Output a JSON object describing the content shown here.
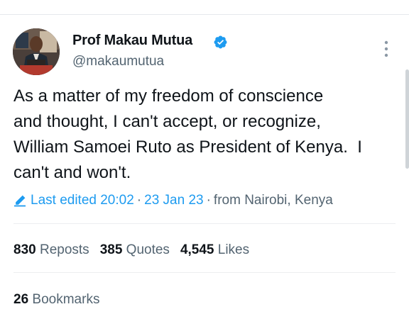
{
  "author": {
    "name": "Prof Makau Mutua",
    "handle": "@makaumutua",
    "verified": true,
    "verified_color": "#1d9bf0"
  },
  "tweet": {
    "text": "As a matter of my freedom of conscience\nand thought, I can't accept, or recognize,\nWilliam Samoei Ruto as President of Kenya.  I\ncan't and won't."
  },
  "meta": {
    "edited_label": "Last edited 20:02",
    "date": "23 Jan 23",
    "location": "from Nairobi, Kenya",
    "separator": "·",
    "link_color": "#1d9bf0"
  },
  "stats": {
    "reposts": {
      "count": "830",
      "label": "Reposts"
    },
    "quotes": {
      "count": "385",
      "label": "Quotes"
    },
    "likes": {
      "count": "4,545",
      "label": "Likes"
    },
    "bookmarks": {
      "count": "26",
      "label": "Bookmarks"
    }
  },
  "icons": {
    "verified": "verified-badge-icon",
    "more": "more-vertical-icon",
    "edit": "pencil-icon"
  }
}
